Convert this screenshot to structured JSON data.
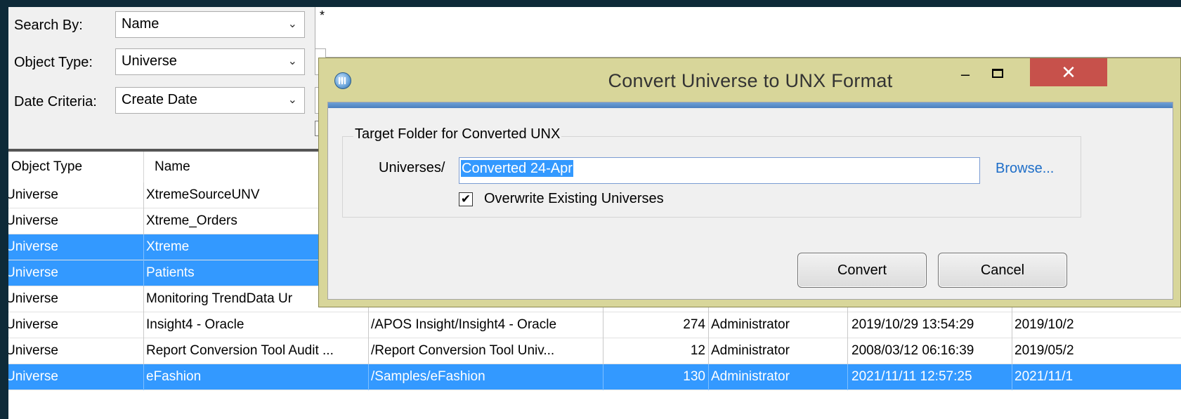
{
  "filters": {
    "search_by_label": "Search By:",
    "search_by_value": "Name",
    "object_type_label": "Object Type:",
    "object_type_value": "Universe",
    "date_criteria_label": "Date Criteria:",
    "date_criteria_value": "Create Date",
    "search_text": "*"
  },
  "table": {
    "headers": [
      "Object Type",
      "Name"
    ],
    "rows": [
      {
        "type": "Universe",
        "name": "XtremeSourceUNV",
        "path": "",
        "size": "",
        "owner": "",
        "created": "",
        "modified": "",
        "selected": false
      },
      {
        "type": "Universe",
        "name": "Xtreme_Orders",
        "path": "",
        "size": "",
        "owner": "",
        "created": "",
        "modified": "",
        "selected": false
      },
      {
        "type": "Universe",
        "name": "Xtreme",
        "path": "",
        "size": "",
        "owner": "",
        "created": "",
        "modified": "",
        "selected": true
      },
      {
        "type": "Universe",
        "name": "Patients",
        "path": "",
        "size": "",
        "owner": "",
        "created": "",
        "modified": "",
        "selected": true
      },
      {
        "type": "Universe",
        "name": "Monitoring TrendData Ur",
        "path": "",
        "size": "",
        "owner": "",
        "created": "",
        "modified": "",
        "selected": false
      },
      {
        "type": "Universe",
        "name": "Insight4 - Oracle",
        "path": "/APOS Insight/Insight4 - Oracle",
        "size": "274",
        "owner": "Administrator",
        "created": "2019/10/29 13:54:29",
        "modified": "2019/10/2",
        "selected": false
      },
      {
        "type": "Universe",
        "name": "Report Conversion Tool Audit ...",
        "path": "/Report Conversion Tool Univ...",
        "size": "12",
        "owner": "Administrator",
        "created": "2008/03/12 06:16:39",
        "modified": "2019/05/2",
        "selected": false
      },
      {
        "type": "Universe",
        "name": "eFashion",
        "path": "/Samples/eFashion",
        "size": "130",
        "owner": "Administrator",
        "created": "2021/11/11 12:57:25",
        "modified": "2021/11/1",
        "selected": true
      }
    ]
  },
  "dialog": {
    "title": "Convert Universe to UNX Format",
    "minimize_glyph": "–",
    "close_glyph": "✕",
    "group_title": "Target Folder for Converted UNX",
    "path_prefix": "Universes/",
    "folder_value": "Converted 24-Apr",
    "browse_label": "Browse...",
    "overwrite_label": "Overwrite Existing Universes",
    "overwrite_checked": true,
    "check_glyph": "✔",
    "convert_label": "Convert",
    "cancel_label": "Cancel"
  },
  "icons": {
    "combo_chevron": "⌄",
    "app_icon": "globe-icon"
  },
  "colors": {
    "selection": "#3399ff",
    "dialog_frame": "#d8d69a",
    "close_button": "#c7514b",
    "background": "#0e2a38"
  }
}
